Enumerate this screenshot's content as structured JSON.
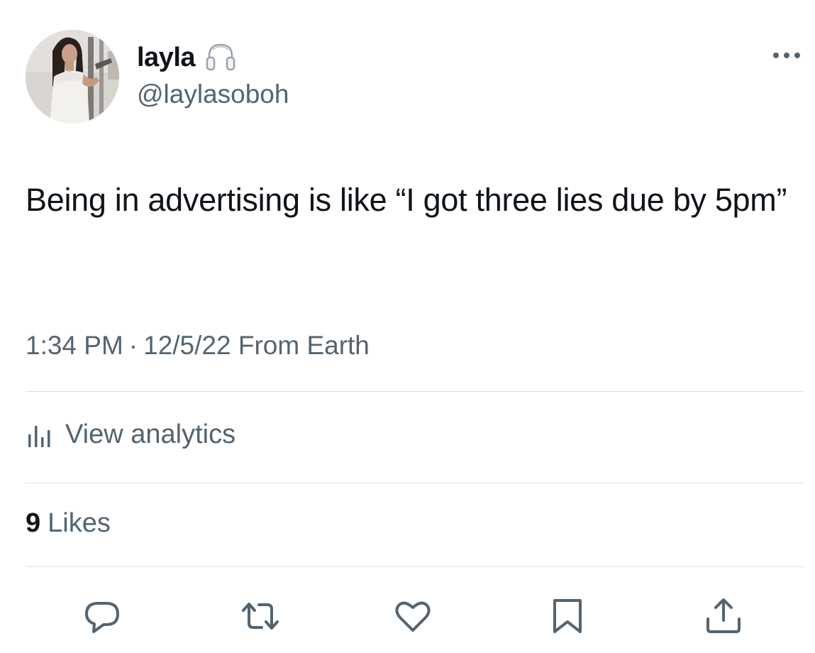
{
  "user": {
    "display_name": "layla",
    "handle": "@laylasoboh",
    "badge_icon": "headphones-icon",
    "avatar_icon": "profile-photo"
  },
  "tweet": {
    "text": "Being in advertising is like “I got three lies due by 5pm”",
    "time": "1:34 PM",
    "separator": "·",
    "date_source": "12/5/22 From Earth"
  },
  "analytics": {
    "label": "View analytics",
    "icon": "bar-chart-icon"
  },
  "likes": {
    "count": "9",
    "label": "Likes"
  },
  "actions": [
    {
      "name": "reply",
      "icon": "speech-bubble-icon"
    },
    {
      "name": "retweet",
      "icon": "retweet-arrows-icon"
    },
    {
      "name": "like",
      "icon": "heart-icon"
    },
    {
      "name": "bookmark",
      "icon": "bookmark-icon"
    },
    {
      "name": "share",
      "icon": "upload-share-icon"
    }
  ],
  "colors": {
    "primary_text": "#0f1419",
    "secondary_text": "#536471",
    "divider": "#dfe3e7",
    "background": "#ffffff"
  }
}
